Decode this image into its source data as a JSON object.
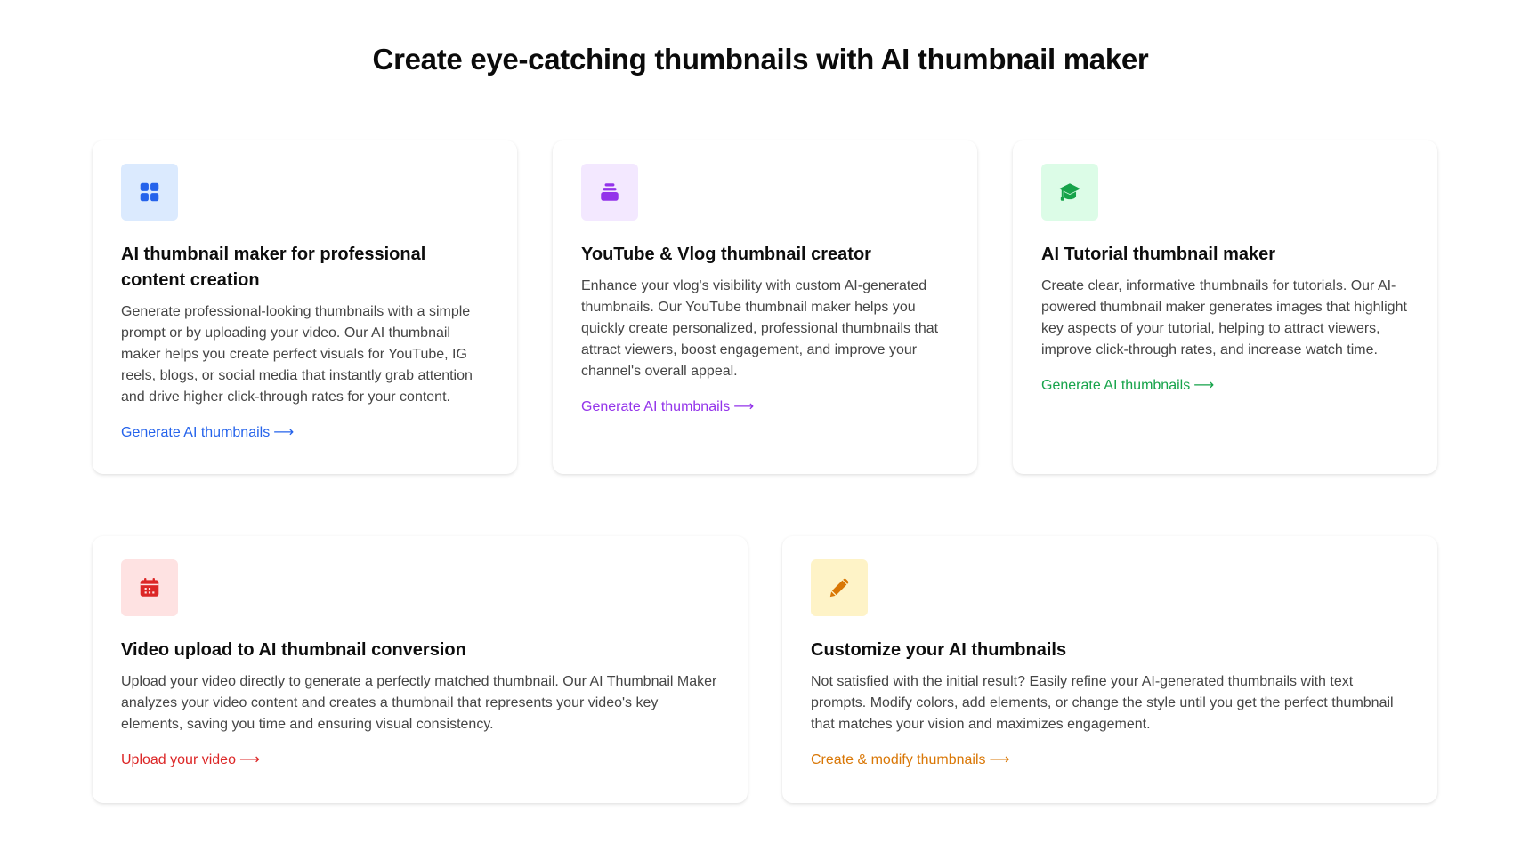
{
  "page": {
    "title": "Create eye-catching thumbnails with AI thumbnail maker"
  },
  "cards": [
    {
      "icon": "grid-icon",
      "icon_color": "#2563eb",
      "icon_bg": "#dbeafe",
      "title": "AI thumbnail maker for professional content creation",
      "description": "Generate professional-looking thumbnails with a simple prompt or by uploading your video. Our AI thumbnail maker helps you create perfect visuals for YouTube, IG reels, blogs, or social media that instantly grab attention and drive higher click-through rates for your content.",
      "link_label": "Generate AI thumbnails",
      "link_color": "#2563eb"
    },
    {
      "icon": "stack-icon",
      "icon_color": "#9333ea",
      "icon_bg": "#f3e8ff",
      "title": "YouTube & Vlog thumbnail creator",
      "description": "Enhance your vlog's visibility with custom AI-generated thumbnails. Our YouTube thumbnail maker helps you quickly create personalized, professional thumbnails that attract viewers, boost engagement, and improve your channel's overall appeal.",
      "link_label": "Generate AI thumbnails",
      "link_color": "#9333ea"
    },
    {
      "icon": "graduation-cap-icon",
      "icon_color": "#16a34a",
      "icon_bg": "#dcfce7",
      "title": "AI Tutorial thumbnail maker",
      "description": "Create clear, informative thumbnails for tutorials. Our AI-powered thumbnail maker generates images that highlight key aspects of your tutorial, helping to attract viewers, improve click-through rates, and increase watch time.",
      "link_label": "Generate AI thumbnails",
      "link_color": "#16a34a"
    },
    {
      "icon": "calendar-icon",
      "icon_color": "#dc2626",
      "icon_bg": "#fee2e2",
      "title": "Video upload to AI thumbnail conversion",
      "description": "Upload your video directly to generate a perfectly matched thumbnail. Our AI Thumbnail Maker analyzes your video content and creates a thumbnail that represents your video's key elements, saving you time and ensuring visual consistency.",
      "link_label": "Upload your video",
      "link_color": "#dc2626"
    },
    {
      "icon": "pencil-icon",
      "icon_color": "#d97706",
      "icon_bg": "#fef3c7",
      "title": "Customize your AI thumbnails",
      "description": "Not satisfied with the initial result? Easily refine your AI-generated thumbnails with text prompts. Modify colors, add elements, or change the style until you get the perfect thumbnail that matches your vision and maximizes engagement.",
      "link_label": "Create & modify thumbnails",
      "link_color": "#d97706"
    }
  ],
  "arrow_glyph": "⟶"
}
